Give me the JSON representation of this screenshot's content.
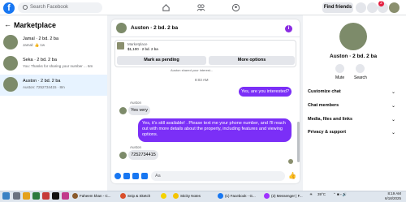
{
  "topbar": {
    "logo": "f",
    "search_placeholder": "Search Facebook",
    "find_friends": "Find friends",
    "notification_count": "2"
  },
  "left": {
    "title": "Marketplace",
    "conversations": [
      {
        "name": "Jamal · 2 bd. 2 ba",
        "sub": "Jamal: 👍 1w"
      },
      {
        "name": "Seka · 2 bd. 2 ba",
        "sub": "You: Thanks for sharing your number ... 6m"
      },
      {
        "name": "Auston · 2 bd. 2 ba",
        "sub": "Auston: 7252734415 · 8m"
      }
    ]
  },
  "chat": {
    "name": "Auston · 2 bd. 2 ba",
    "listing_title": "Marketplace",
    "listing_price": "$1,100 · 2 bd. 2 ba",
    "mark_pending": "Mark as pending",
    "more_options": "More options",
    "cut_text": "Auston shared your interest...",
    "timestamp": "8:03 AM",
    "messages": [
      {
        "from": "me",
        "text": "Yes, are you interested?"
      },
      {
        "from": "them",
        "sender": "Auston",
        "text": "Yes very"
      },
      {
        "from": "me",
        "text": "Yes, it's still available! . Please text me your phone number, and I'll reach out with more details about the property, including features and viewing options."
      },
      {
        "from": "them",
        "sender": "Auston",
        "text": "7252734415"
      }
    ],
    "composer_placeholder": "Aa"
  },
  "right": {
    "name": "Auston · 2 bd. 2 ba",
    "mute": "Mute",
    "search": "Search",
    "sections": [
      "Customize chat",
      "Chat members",
      "Media, files and links",
      "Privacy & support"
    ]
  },
  "taskbar": {
    "apps": [
      "Faheem khan - C...",
      "Snip & Sketch",
      "Sticky Notes",
      "(1) Facebook - G...",
      "(2) Messenger | F..."
    ],
    "weather": "39°C",
    "time": "8:19 AM",
    "date": "6/18/2025"
  }
}
